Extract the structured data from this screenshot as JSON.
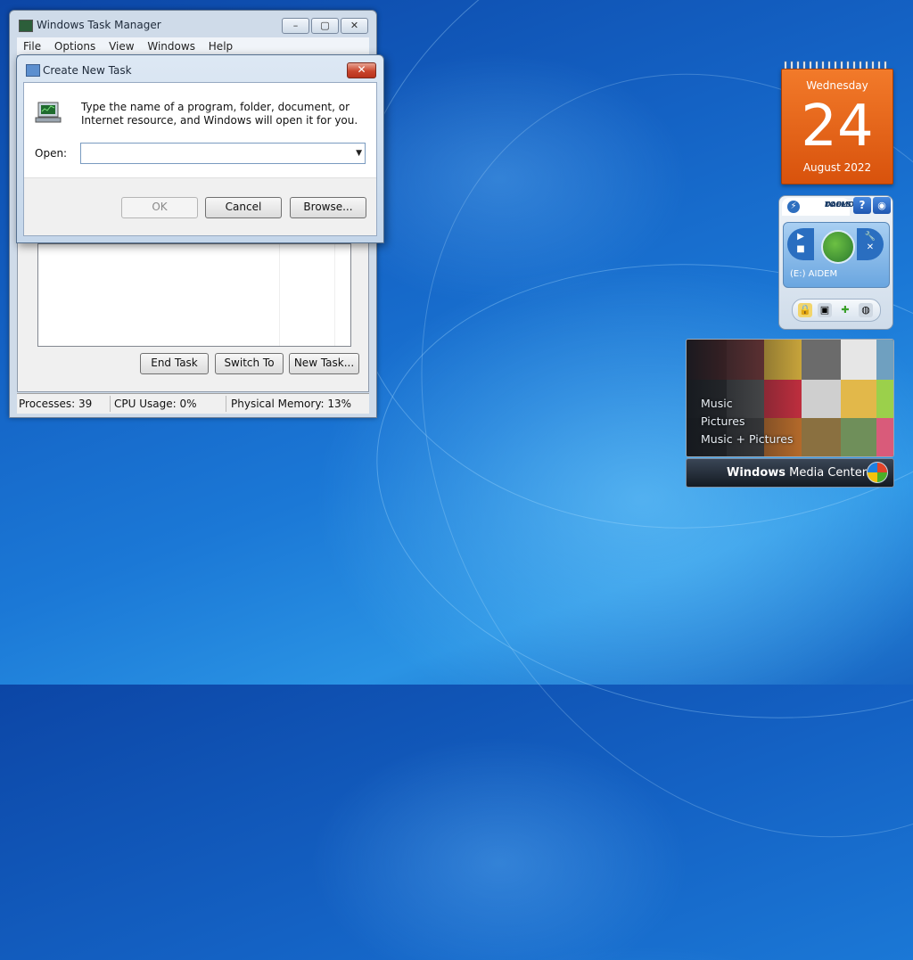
{
  "task_manager": {
    "title": "Windows Task Manager",
    "caption_buttons": [
      "–",
      "▢",
      "✕"
    ],
    "menu": [
      "File",
      "Options",
      "View",
      "Windows",
      "Help"
    ],
    "buttons": {
      "end_task": "End Task",
      "switch_to": "Switch To",
      "new_task": "New Task..."
    },
    "status": {
      "processes": "Processes: 39",
      "cpu": "CPU Usage: 0%",
      "memory": "Physical Memory: 13%"
    }
  },
  "dialog": {
    "title": "Create New Task",
    "close": "✕",
    "description": "Type the name of a program, folder, document, or Internet resource, and Windows will open it for you.",
    "open_label": "Open:",
    "open_value": "",
    "ok": "OK",
    "cancel": "Cancel",
    "browse": "Browse..."
  },
  "calendar": {
    "weekday": "Wednesday",
    "day": "24",
    "month_year": "August 2022"
  },
  "daemon_tools": {
    "logo_line1": "DAEMON",
    "logo_line2": "TOOLS",
    "help": "?",
    "drive": "(E:) AIDEM"
  },
  "media_center": {
    "items": [
      "Music",
      "Pictures",
      "Music + Pictures"
    ],
    "brand_bold": "Windows",
    "brand_rest": " Media Center"
  },
  "colors": {
    "desktop": "#1462c4",
    "calendar": "#e8651c",
    "close_button": "#c9452d"
  }
}
